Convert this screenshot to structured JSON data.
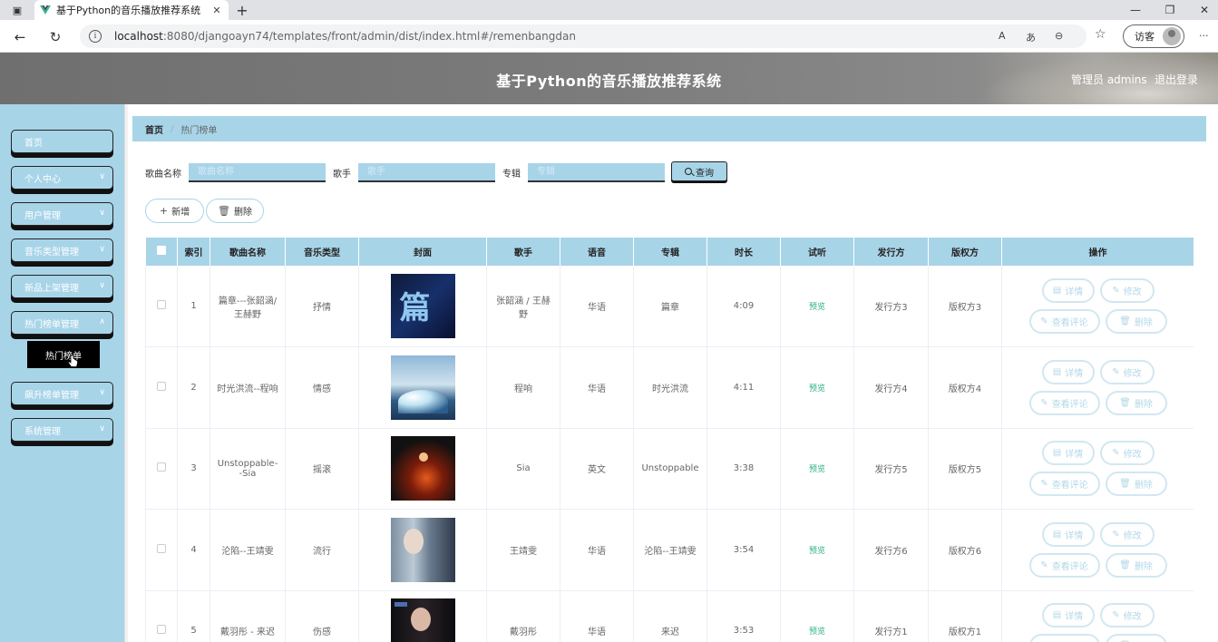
{
  "browser": {
    "tab_title": "基于Python的音乐播放推荐系统",
    "url_host": "localhost",
    "url_path": ":8080/djangoayn74/templates/front/admin/dist/index.html#/remenbangdan",
    "guest_label": "访客"
  },
  "header": {
    "title": "基于Python的音乐播放推荐系统",
    "admin": "管理员 admins",
    "logout": "退出登录"
  },
  "sidebar": {
    "items": [
      {
        "label": "首页"
      },
      {
        "label": "个人中心"
      },
      {
        "label": "用户管理"
      },
      {
        "label": "音乐类型管理"
      },
      {
        "label": "新品上架管理"
      },
      {
        "label": "热门榜单管理"
      },
      {
        "label": "飙升榜单管理"
      },
      {
        "label": "系统管理"
      }
    ],
    "submenu_active": "热门榜单"
  },
  "breadcrumb": {
    "home": "首页",
    "current": "热门榜单"
  },
  "search": {
    "song_label": "歌曲名称",
    "song_placeholder": "歌曲名称",
    "singer_label": "歌手",
    "singer_placeholder": "歌手",
    "album_label": "专辑",
    "album_placeholder": "专辑",
    "query_btn": "查询"
  },
  "actions": {
    "add": "新增",
    "delete": "删除"
  },
  "table": {
    "headers": [
      "索引",
      "歌曲名称",
      "音乐类型",
      "封面",
      "歌手",
      "语音",
      "专辑",
      "时长",
      "试听",
      "发行方",
      "版权方",
      "操作"
    ],
    "rows": [
      {
        "index": "1",
        "song": "篇章---张韶涵/王赫野",
        "type": "抒情",
        "singer": "张韶涵 / 王赫野",
        "lang": "华语",
        "album": "篇章",
        "duration": "4:09",
        "preview": "预览",
        "publisher": "发行方3",
        "copyright": "版权方3"
      },
      {
        "index": "2",
        "song": "时光洪流--程响",
        "type": "情感",
        "singer": "程响",
        "lang": "华语",
        "album": "时光洪流",
        "duration": "4:11",
        "preview": "预览",
        "publisher": "发行方4",
        "copyright": "版权方4"
      },
      {
        "index": "3",
        "song": "Unstoppable--Sia",
        "type": "摇滚",
        "singer": "Sia",
        "lang": "英文",
        "album": "Unstoppable",
        "duration": "3:38",
        "preview": "预览",
        "publisher": "发行方5",
        "copyright": "版权方5"
      },
      {
        "index": "4",
        "song": "沦陷--王靖雯",
        "type": "流行",
        "singer": "王靖雯",
        "lang": "华语",
        "album": "沦陷--王靖雯",
        "duration": "3:54",
        "preview": "预览",
        "publisher": "发行方6",
        "copyright": "版权方6"
      },
      {
        "index": "5",
        "song": "戴羽彤 - 来迟",
        "type": "伤感",
        "singer": "戴羽彤",
        "lang": "华语",
        "album": "来迟",
        "duration": "3:53",
        "preview": "预览",
        "publisher": "发行方1",
        "copyright": "版权方1"
      }
    ],
    "ops": {
      "detail": "详情",
      "edit": "修改",
      "comments": "查看评论",
      "delete": "删除"
    }
  }
}
